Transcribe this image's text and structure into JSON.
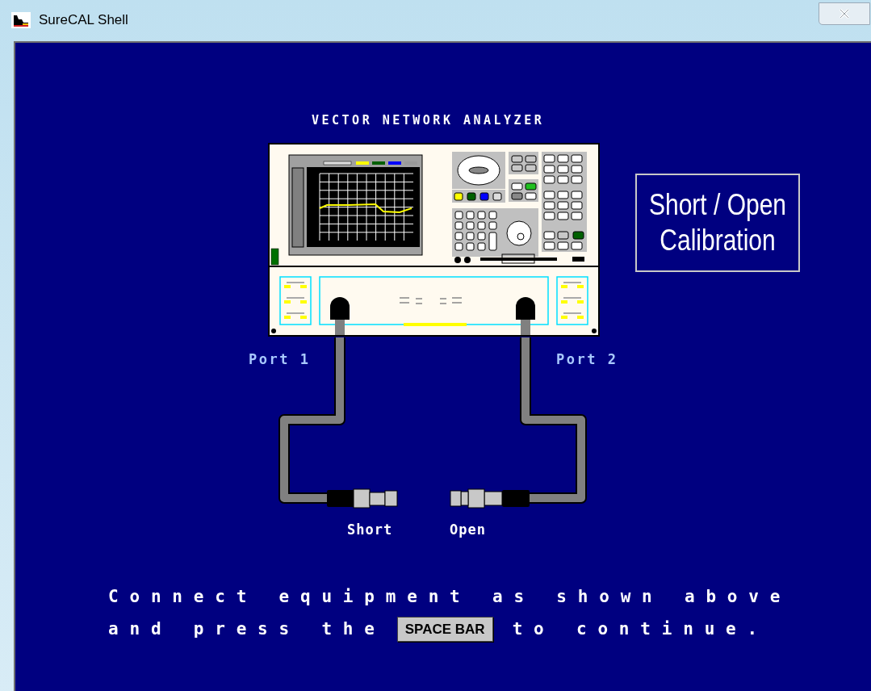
{
  "window": {
    "title": "SureCAL Shell"
  },
  "diagram": {
    "title": "VECTOR NETWORK ANALYZER",
    "ports": [
      "Port 1",
      "Port 2"
    ],
    "terminations": [
      "Short",
      "Open"
    ]
  },
  "calibration_box": {
    "lines": [
      "Short / Open",
      "Calibration"
    ]
  },
  "instruction": {
    "line_1": "Connect equipment as shown above",
    "line_2_before": "and press the",
    "key": "SPACE BAR",
    "line_2_after": "to continue."
  }
}
